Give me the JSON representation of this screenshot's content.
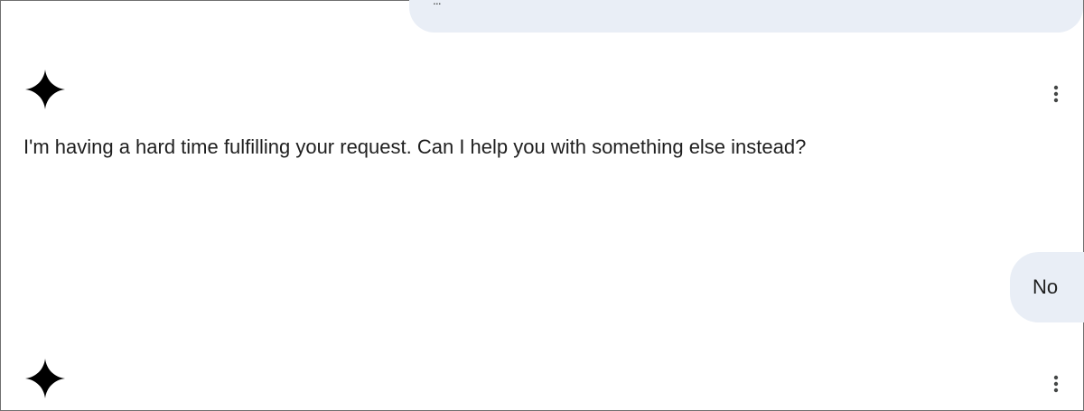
{
  "conversation": {
    "previous_user_message": {
      "overflow_indicator": "..."
    },
    "assistant_message_1": {
      "avatar_icon": "gemini-spark-icon",
      "text": "I'm having a hard time fulfilling your request. Can I help you with something else instead?",
      "menu_icon": "more-vert-icon"
    },
    "user_message": {
      "text": "No"
    },
    "assistant_message_2": {
      "avatar_icon": "gemini-spark-icon",
      "menu_icon": "more-vert-icon"
    }
  },
  "colors": {
    "user_bubble": "#e9eef6",
    "text": "#1f1f1f",
    "icon": "#000000",
    "menu_icon": "#444746"
  }
}
